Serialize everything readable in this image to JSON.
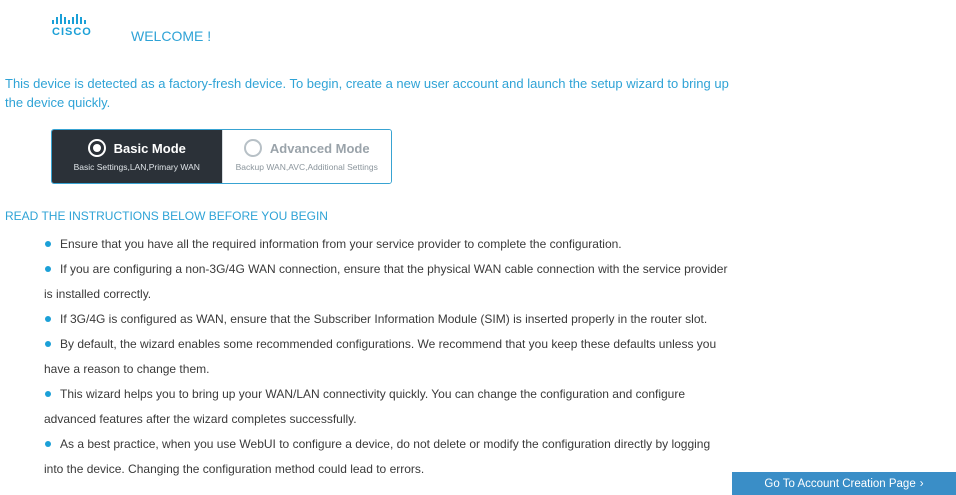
{
  "brand": {
    "logo_text": "CISCO"
  },
  "header": {
    "welcome": "WELCOME !"
  },
  "intro": {
    "text": "This device is detected as a factory-fresh device. To begin, create a new user account and launch the setup wizard to bring up the device quickly."
  },
  "modes": {
    "basic": {
      "title": "Basic Mode",
      "subtitle": "Basic Settings,LAN,Primary WAN",
      "selected": true
    },
    "advanced": {
      "title": "Advanced Mode",
      "subtitle": "Backup WAN,AVC,Additional Settings",
      "selected": false
    }
  },
  "instructions": {
    "title": "READ THE INSTRUCTIONS BELOW BEFORE YOU BEGIN",
    "items": [
      {
        "line1": "Ensure that you have all the required information from your service provider to complete the configuration.",
        "line2": ""
      },
      {
        "line1": "If you are configuring a non-3G/4G WAN connection, ensure that the physical WAN cable connection with the service provider",
        "line2": "is installed correctly."
      },
      {
        "line1": "If 3G/4G is configured as WAN, ensure that the Subscriber Information Module (SIM) is inserted properly in the router slot.",
        "line2": ""
      },
      {
        "line1": "By default, the wizard enables some recommended configurations. We recommend that you keep these defaults unless you",
        "line2": "have a reason to change them."
      },
      {
        "line1": "This wizard helps you to bring up your WAN/LAN connectivity quickly. You can change the configuration and configure",
        "line2": "advanced features after the wizard completes successfully."
      },
      {
        "line1": "As a best practice, when you use WebUI to configure a device, do not delete or modify the configuration directly by logging",
        "line2": "into the device. Changing the configuration method could lead to errors."
      }
    ]
  },
  "footer": {
    "go_button": "Go To Account Creation Page",
    "go_icon": "chevron-right-icon"
  },
  "colors": {
    "accent": "#2fa3d6",
    "dark_mode_bg": "#2b3138",
    "button_bg": "#3a8ec7"
  }
}
